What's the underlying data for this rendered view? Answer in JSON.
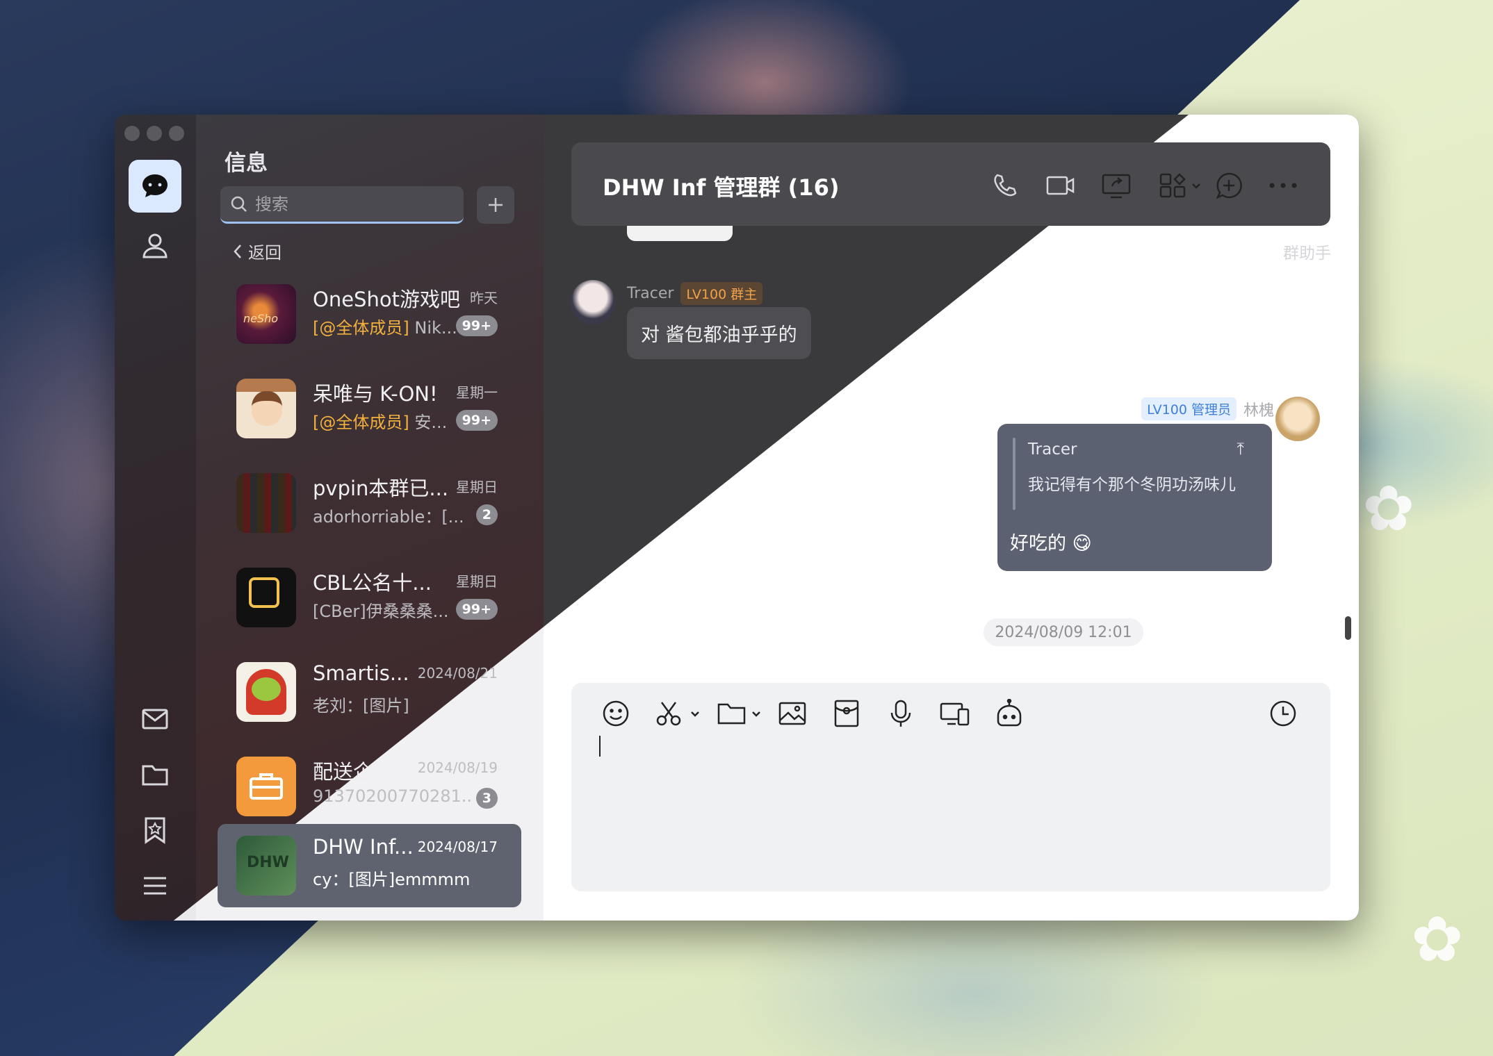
{
  "app": {
    "section_title": "信息"
  },
  "search": {
    "placeholder": "搜索"
  },
  "nav": {
    "back_label": "返回",
    "helper_label": "群助手"
  },
  "chats": [
    {
      "title": "OneShot游戏吧",
      "time": "昨天",
      "mention": "[@全体成员]",
      "preview": " Nik...",
      "badge": "99+"
    },
    {
      "title": "呆唯与 K-ON!",
      "time": "星期一",
      "mention": "[@全体成员]",
      "preview": " 安...",
      "badge": "99+"
    },
    {
      "title": "pvpin本群已...",
      "time": "星期日",
      "mention": "",
      "preview": "adorhorriable：[...",
      "badge": "2"
    },
    {
      "title": "CBL公名十...",
      "time": "星期日",
      "mention": "",
      "preview": "[CBer]伊桑桑桑...",
      "badge": "99+"
    },
    {
      "title": "Smartis...",
      "time": "2024/08/21",
      "mention": "",
      "preview": "老刘：[图片]",
      "badge": ""
    },
    {
      "title": "配送企...",
      "time": "2024/08/19",
      "mention": "",
      "preview": "91370200770281...",
      "badge": "3"
    },
    {
      "title": "DHW Inf...",
      "time": "2024/08/17",
      "mention": "",
      "preview": "cy：[图片]emmmm，...",
      "badge": ""
    }
  ],
  "conversation": {
    "title": "DHW Inf 管理群 (16)",
    "messages": [
      {
        "sender": "Tracer",
        "level": "LV100 群主",
        "text": "对 酱包都油乎乎的"
      },
      {
        "sender": "林槐",
        "level": "LV100 管理员",
        "quote_author": "Tracer",
        "quote_text": "我记得有个那个冬阴功汤味儿",
        "text": "好吃的 😋"
      }
    ],
    "timestamp": "2024/08/09 12:01"
  },
  "colors": {
    "accent": "#2a7ef5",
    "mention": "#f2b13d",
    "owner_badge": "#f0a24d",
    "admin_badge": "#3f7fd6"
  }
}
